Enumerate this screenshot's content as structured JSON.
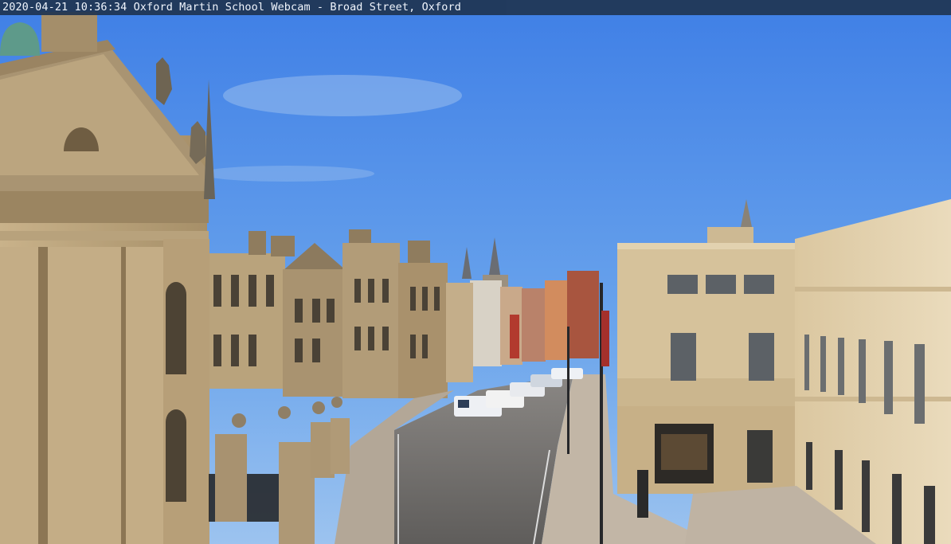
{
  "overlay": {
    "timestamp": "2020-04-21 10:36:34",
    "caption": "Oxford Martin School Webcam - Broad Street, Oxford"
  },
  "colors": {
    "sky_top": "#3d7be3",
    "sky_bottom": "#7fb2ee",
    "stone_light": "#e3cfa8",
    "stone_mid": "#c8ad80",
    "stone_dark": "#7d6a4c",
    "road": "#6f6d6b",
    "pavement": "#b9aea0"
  }
}
